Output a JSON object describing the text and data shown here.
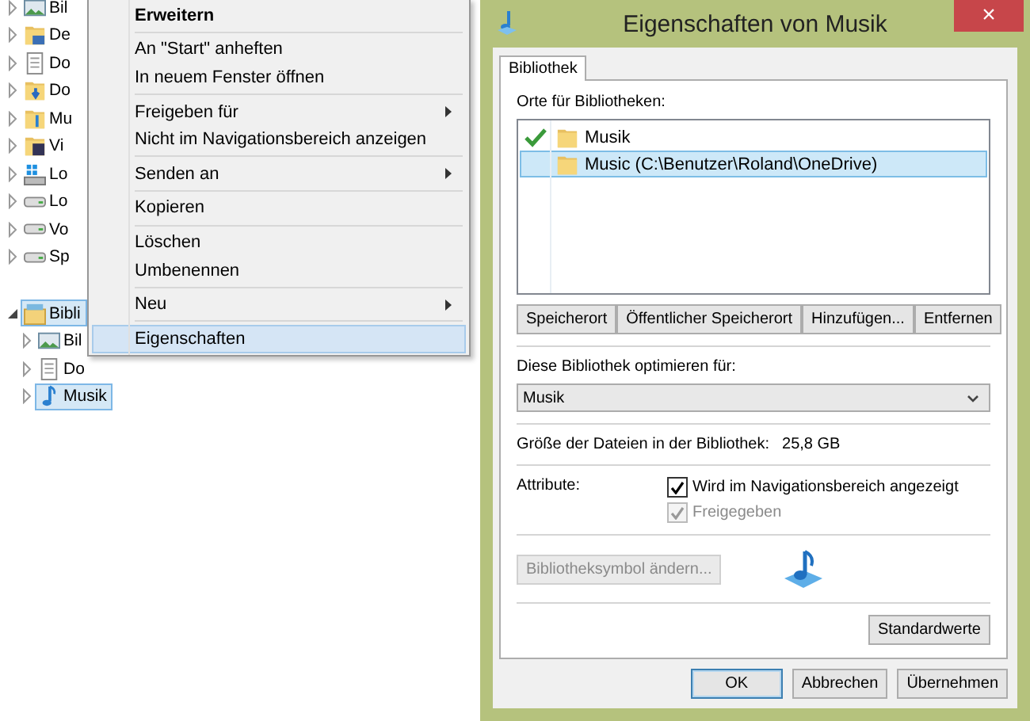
{
  "tree": {
    "items": [
      {
        "label": "Bil",
        "kind": "pictures",
        "selected": false,
        "expanded": false
      },
      {
        "label": "De",
        "kind": "desktop",
        "selected": false,
        "expanded": false
      },
      {
        "label": "Do",
        "kind": "documents",
        "selected": false,
        "expanded": false
      },
      {
        "label": "Do",
        "kind": "downloads",
        "selected": false,
        "expanded": false
      },
      {
        "label": "Mu",
        "kind": "music",
        "selected": false,
        "expanded": false
      },
      {
        "label": "Vi",
        "kind": "videos",
        "selected": false,
        "expanded": false
      },
      {
        "label": "Lo",
        "kind": "windrive",
        "selected": false,
        "expanded": false
      },
      {
        "label": "Lo",
        "kind": "drive",
        "selected": false,
        "expanded": false
      },
      {
        "label": "Vo",
        "kind": "drive",
        "selected": false,
        "expanded": false
      },
      {
        "label": "Sp",
        "kind": "drive",
        "selected": false,
        "expanded": false
      },
      {
        "label": "Bibli",
        "kind": "library",
        "selected": true,
        "expanded": true,
        "children": [
          {
            "label": "Bil",
            "kind": "pictures",
            "selected": false,
            "expanded": false
          },
          {
            "label": "Do",
            "kind": "documents",
            "selected": false,
            "expanded": false
          },
          {
            "label": "Musik",
            "kind": "note",
            "selected": true,
            "expanded": false
          }
        ]
      }
    ]
  },
  "context_menu": {
    "groups": [
      [
        {
          "label": "Erweitern",
          "default": true,
          "submenu": false,
          "selected": false
        }
      ],
      [
        {
          "label": "An \"Start\" anheften",
          "default": false,
          "submenu": false,
          "selected": false
        },
        {
          "label": "In neuem Fenster öffnen",
          "default": false,
          "submenu": false,
          "selected": false
        }
      ],
      [
        {
          "label": "Freigeben für",
          "default": false,
          "submenu": true,
          "selected": false
        },
        {
          "label": "Nicht im Navigationsbereich anzeigen",
          "default": false,
          "submenu": false,
          "selected": false
        }
      ],
      [
        {
          "label": "Senden an",
          "default": false,
          "submenu": true,
          "selected": false
        }
      ],
      [
        {
          "label": "Kopieren",
          "default": false,
          "submenu": false,
          "selected": false
        }
      ],
      [
        {
          "label": "Löschen",
          "default": false,
          "submenu": false,
          "selected": false
        },
        {
          "label": "Umbenennen",
          "default": false,
          "submenu": false,
          "selected": false
        }
      ],
      [
        {
          "label": "Neu",
          "default": false,
          "submenu": true,
          "selected": false
        }
      ],
      [
        {
          "label": "Eigenschaften",
          "default": false,
          "submenu": false,
          "selected": true
        }
      ]
    ]
  },
  "dialog": {
    "title": "Eigenschaften von Musik",
    "close": "×",
    "tabs": [
      {
        "label": "Bibliothek",
        "selected": true
      }
    ],
    "locations_label": "Orte für Bibliotheken:",
    "locations": [
      {
        "label": "Musik",
        "default_location": true,
        "selected": false
      },
      {
        "label": "Music (C:\\Benutzer\\Roland\\OneDrive)",
        "default_location": false,
        "selected": true
      }
    ],
    "location_buttons": [
      "Speicherort",
      "Öffentlicher Speicherort",
      "Hinzufügen...",
      "Entfernen"
    ],
    "optimize_label": "Diese Bibliothek optimieren für:",
    "optimize_value": "Musik",
    "size_label": "Größe der Dateien in der Bibliothek:",
    "size_value": "25,8 GB",
    "attributes_label": "Attribute:",
    "attributes": [
      {
        "label": "Wird im Navigationsbereich angezeigt",
        "checked": true,
        "disabled": false
      },
      {
        "label": "Freigegeben",
        "checked": true,
        "disabled": true
      }
    ],
    "icon_button": {
      "label": "Bibliotheksymbol ändern...",
      "disabled": true
    },
    "defaults_button": "Standardwerte",
    "buttons": [
      {
        "label": "OK",
        "default": true
      },
      {
        "label": "Abbrechen",
        "default": false
      },
      {
        "label": "Übernehmen",
        "default": false
      }
    ]
  }
}
